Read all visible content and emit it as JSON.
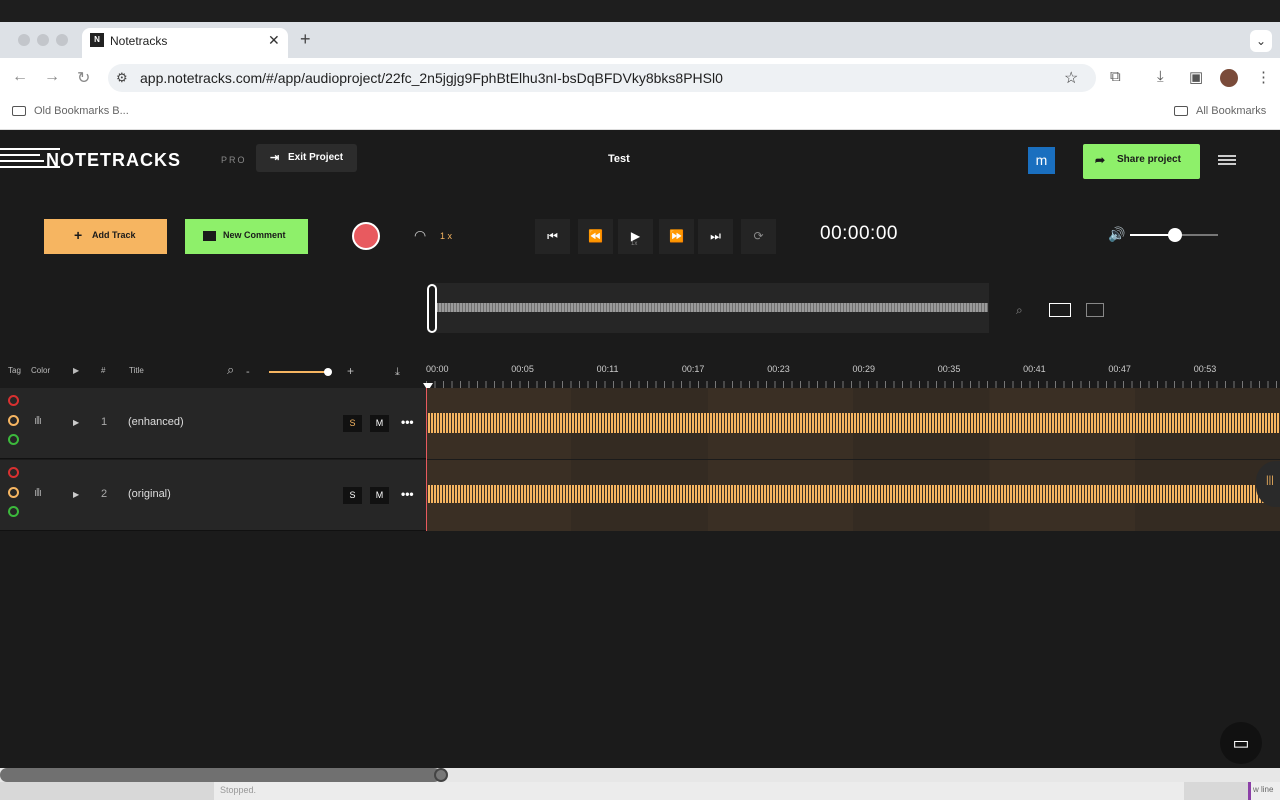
{
  "browser": {
    "tab_title": "Notetracks",
    "favicon_text": "N",
    "url": "app.notetracks.com/#/app/audioproject/22fc_2n5jgjg9FphBtElhu3nI-bsDqBFDVky8bks8PHSl0",
    "bookmarks": {
      "left": "Old Bookmarks B...",
      "right": "All Bookmarks"
    }
  },
  "app": {
    "logo": "NOTETRACKS",
    "plan": "PRO",
    "exit_label": "Exit Project",
    "project_title": "Test",
    "user_initial": "m",
    "share_label": "Share project"
  },
  "toolbar": {
    "add_track_label": "Add Track",
    "new_comment_label": "New Comment",
    "speed": "1 x",
    "play_sub": "1x",
    "time": "00:00:00",
    "volume_level": 0.5
  },
  "list_header": {
    "tag": "Tag",
    "color": "Color",
    "num": "#",
    "title": "Title",
    "zoom_minus": "-",
    "zoom_plus": "+"
  },
  "timeline": {
    "ticks": [
      "00:00",
      "00:05",
      "00:11",
      "00:17",
      "00:23",
      "00:29",
      "00:35",
      "00:41",
      "00:47",
      "00:53"
    ]
  },
  "tracks": [
    {
      "number": "1",
      "title": "(enhanced)",
      "solo": "S",
      "mute": "M"
    },
    {
      "number": "2",
      "title": "(original)",
      "solo": "S",
      "mute": "M"
    }
  ],
  "status": {
    "text": "Stopped.",
    "right": "w line"
  },
  "colors": {
    "accent": "#f6b561",
    "green": "#8ef06a",
    "record": "#e85a5f",
    "bg": "#1b1b1b"
  }
}
